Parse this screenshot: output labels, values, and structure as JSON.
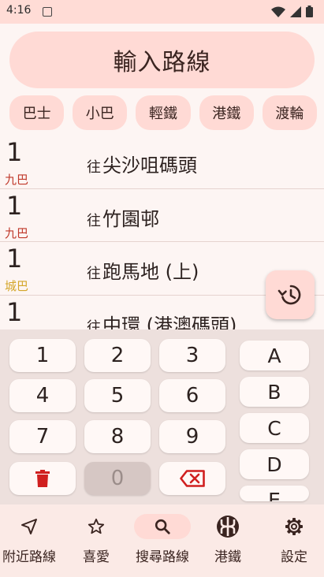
{
  "status_bar": {
    "time": "4:16"
  },
  "route_input": {
    "placeholder": "輸入路線"
  },
  "chips": [
    "巴士",
    "小巴",
    "輕鐵",
    "港鐵",
    "渡輪"
  ],
  "routes": [
    {
      "number": "1",
      "company": "九巴",
      "company_color": "#c0392b",
      "prefix": "往",
      "destination": "尖沙咀碼頭"
    },
    {
      "number": "1",
      "company": "九巴",
      "company_color": "#c0392b",
      "prefix": "往",
      "destination": "竹園邨"
    },
    {
      "number": "1",
      "company": "城巴",
      "company_color": "#d4a62a",
      "prefix": "往",
      "destination": "跑馬地 (上)"
    },
    {
      "number": "1",
      "company": "",
      "company_color": "#c0392b",
      "prefix": "往",
      "destination": "中環 (港澳碼頭)"
    }
  ],
  "keypad": {
    "digits": [
      "1",
      "2",
      "3",
      "4",
      "5",
      "6",
      "7",
      "8",
      "9"
    ],
    "zero": "0",
    "letters": [
      "A",
      "B",
      "C",
      "D",
      "E"
    ]
  },
  "bottom_nav": [
    {
      "label": "附近路線",
      "icon": "navigation-arrow-icon"
    },
    {
      "label": "喜愛",
      "icon": "star-icon"
    },
    {
      "label": "搜尋路線",
      "icon": "search-icon",
      "active": true
    },
    {
      "label": "港鐵",
      "icon": "mtr-logo-icon"
    },
    {
      "label": "設定",
      "icon": "gear-icon"
    }
  ],
  "colors": {
    "accent": "#ffdad5",
    "delete_red": "#d01f1f"
  }
}
